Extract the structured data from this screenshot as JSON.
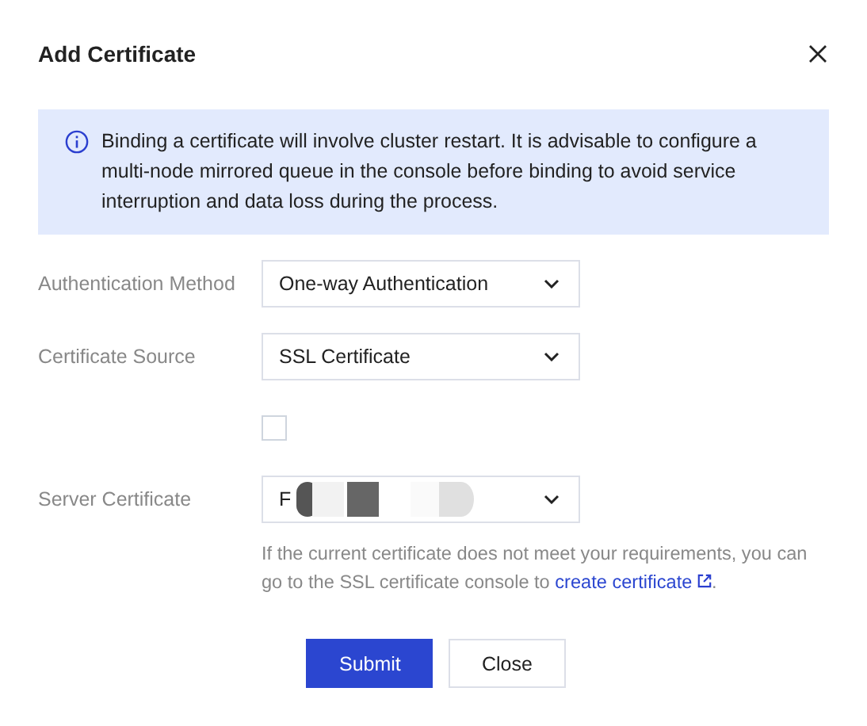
{
  "dialog": {
    "title": "Add Certificate"
  },
  "alert": {
    "text": "Binding a certificate will involve cluster restart. It is advisable to configure a multi-node mirrored queue in the console before binding to avoid service interruption and data loss during the process."
  },
  "fields": [
    {
      "kind": "select",
      "label": "Authentication Method",
      "value": "One-way Authentication"
    },
    {
      "kind": "select",
      "label": "Certificate Source",
      "value": "SSL Certificate"
    },
    {
      "kind": "checkbox",
      "checked": false
    },
    {
      "kind": "select",
      "label": "Server Certificate",
      "value": "F",
      "redacted": true,
      "help": "If the current certificate does not meet your requirements, you can go to the SSL certificate console to",
      "link": "create certificate",
      "after": "."
    }
  ],
  "buttons": [
    {
      "label": "Submit",
      "primary": true
    },
    {
      "label": "Close",
      "primary": false
    }
  ]
}
